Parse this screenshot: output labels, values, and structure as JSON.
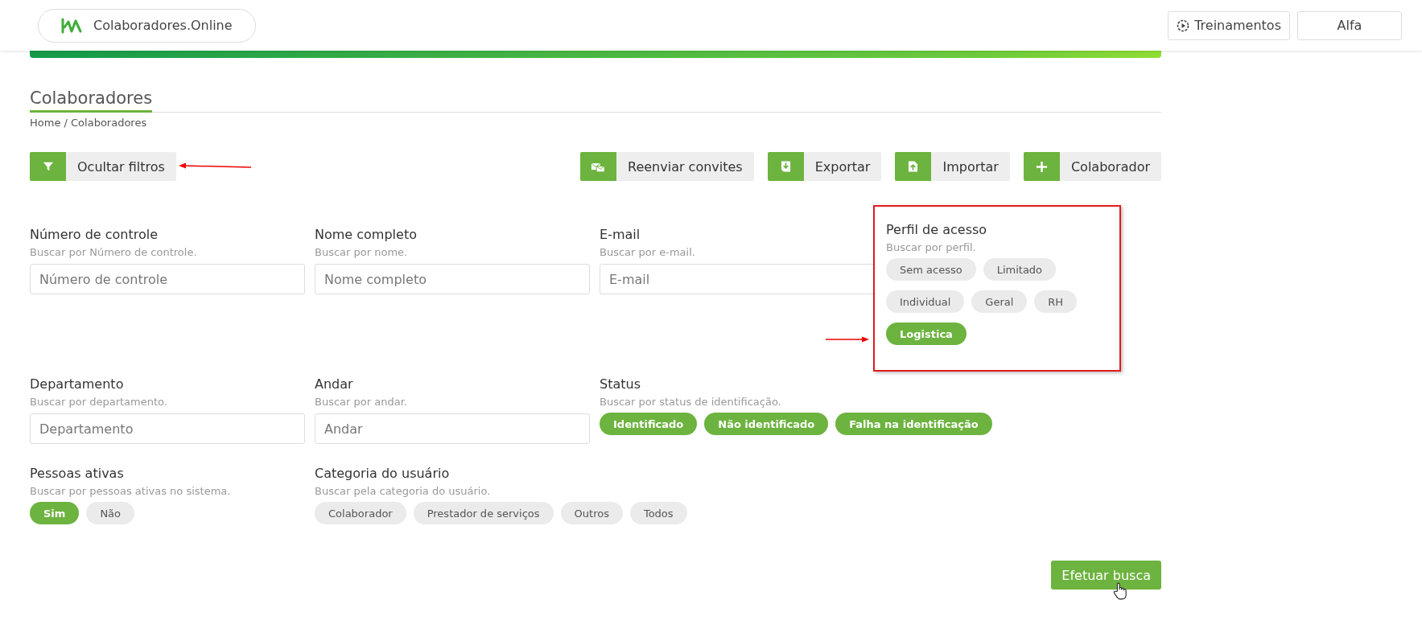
{
  "header": {
    "brand": "Colaboradores.Online",
    "actions": [
      {
        "label": "Treinamentos",
        "kind": "icon"
      },
      {
        "label": "Alfa",
        "kind": "plain"
      }
    ]
  },
  "page": {
    "title": "Colaboradores",
    "breadcrumb": "Home / Colaboradores"
  },
  "toolbar": {
    "toggle": {
      "label": "Ocultar filtros"
    },
    "actions": [
      {
        "label": "Reenviar convites",
        "kind": "mail"
      },
      {
        "label": "Exportar",
        "kind": "export"
      },
      {
        "label": "Importar",
        "kind": "import"
      },
      {
        "label": "Colaborador",
        "kind": "add"
      }
    ]
  },
  "filters": [
    {
      "kind": "text",
      "label": "Número de controle",
      "hint": "Buscar por Número de controle.",
      "placeholder": "Número de controle"
    },
    {
      "kind": "text",
      "label": "Nome completo",
      "hint": "Buscar por nome.",
      "placeholder": "Nome completo"
    },
    {
      "kind": "text",
      "label": "E-mail",
      "hint": "Buscar por e-mail.",
      "placeholder": "E-mail"
    },
    {
      "kind": "chips",
      "highlighted": true,
      "label": "Perfil de acesso",
      "hint": "Buscar por perfil.",
      "options": [
        {
          "label": "Sem acesso",
          "selected": false
        },
        {
          "label": "Limitado",
          "selected": false
        },
        {
          "label": "Individual",
          "selected": false
        },
        {
          "label": "Geral",
          "selected": false
        },
        {
          "label": "RH",
          "selected": false
        },
        {
          "label": "Logistica",
          "selected": true
        }
      ]
    },
    {
      "kind": "text",
      "label": "Departamento",
      "hint": "Buscar por departamento.",
      "placeholder": "Departamento"
    },
    {
      "kind": "text",
      "label": "Andar",
      "hint": "Buscar por andar.",
      "placeholder": "Andar"
    },
    {
      "kind": "chips",
      "label": "Status",
      "hint": "Buscar por status de identificação.",
      "options": [
        {
          "label": "Identificado",
          "selected": true
        },
        {
          "label": "Não identificado",
          "selected": true
        },
        {
          "label": "Falha na identificação",
          "selected": true
        }
      ]
    },
    {
      "kind": "chips",
      "label": "Pessoas ativas",
      "hint": "Buscar por pessoas ativas no sistema.",
      "options": [
        {
          "label": "Sim",
          "selected": true
        },
        {
          "label": "Não",
          "selected": false
        }
      ]
    },
    {
      "kind": "chips",
      "label": "Categoria do usuário",
      "hint": "Buscar pela categoria do usuário.",
      "options": [
        {
          "label": "Colaborador",
          "selected": false
        },
        {
          "label": "Prestador de serviços",
          "selected": false
        },
        {
          "label": "Outros",
          "selected": false
        },
        {
          "label": "Todos",
          "selected": false
        }
      ]
    }
  ],
  "submit": {
    "label": "Efetuar busca"
  }
}
